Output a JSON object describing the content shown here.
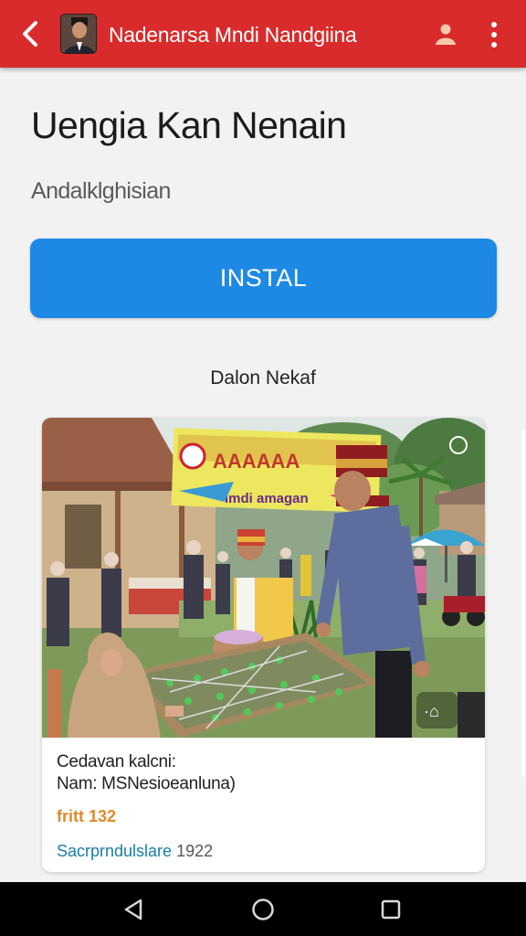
{
  "appbar": {
    "title": "Nadenarsa Mndi Nandgiina",
    "color": "#d92b2b",
    "icons": [
      "back-arrow-icon",
      "user-icon",
      "more-vert-icon"
    ]
  },
  "main": {
    "headline": "Uengia Kan Nenain",
    "subtitle": "Andalklghisian",
    "install_label": "INSTAL",
    "install_color": "#1e88e5",
    "section_label": "Dalon Nekaf"
  },
  "card": {
    "photo_banner_top": "AAAAAA",
    "photo_banner_bottom": "lmdi amagan",
    "caption_line1": "Cedavan kalcni:",
    "caption_line2": "Nam: MSNesioeanluna)",
    "rating": "fritt 132",
    "source_name": "Sacrprndulslare",
    "source_date": "1922"
  },
  "navbar": {
    "icons": [
      "nav-back-icon",
      "nav-home-icon",
      "nav-recents-icon"
    ]
  }
}
